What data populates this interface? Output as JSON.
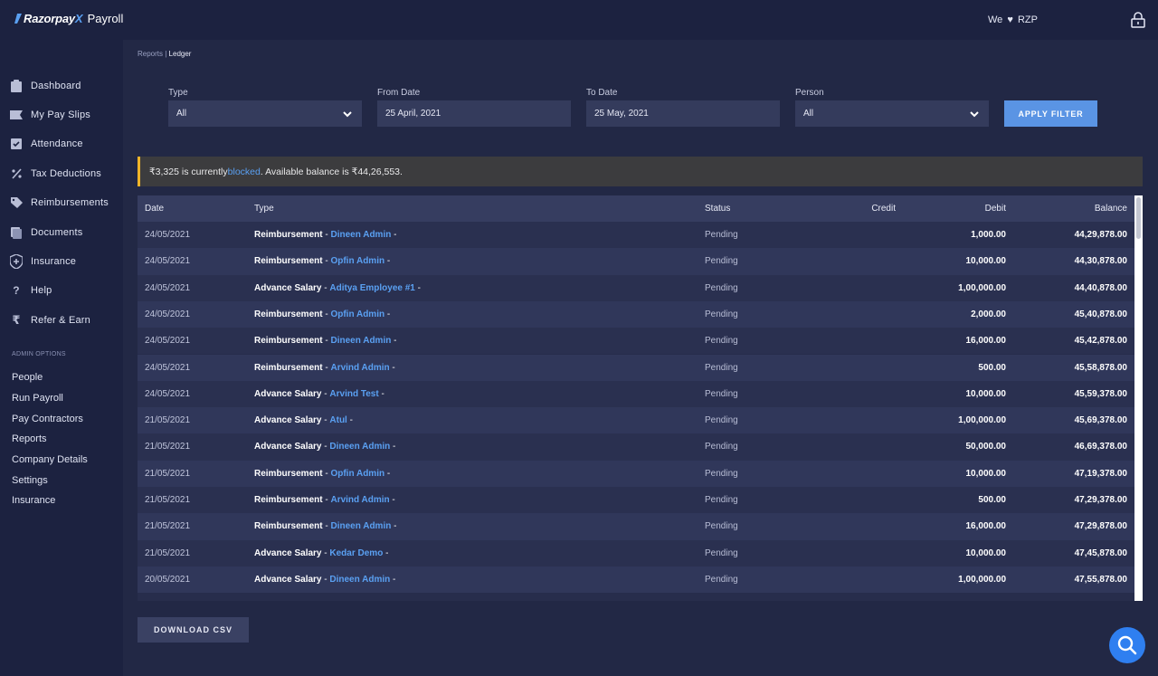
{
  "header": {
    "brand": "Razorpay",
    "brand_mark": "X",
    "product": "Payroll",
    "love_prefix": "We",
    "love_heart": "♥",
    "love_suffix": "RZP"
  },
  "sidebar": {
    "items": [
      {
        "label": "Dashboard",
        "icon": "clipboard-icon"
      },
      {
        "label": "My Pay Slips",
        "icon": "payslip-icon"
      },
      {
        "label": "Attendance",
        "icon": "attendance-check-icon"
      },
      {
        "label": "Tax Deductions",
        "icon": "percent-icon"
      },
      {
        "label": "Reimbursements",
        "icon": "tag-icon"
      },
      {
        "label": "Documents",
        "icon": "documents-icon"
      },
      {
        "label": "Insurance",
        "icon": "shield-plus-icon"
      },
      {
        "label": "Help",
        "icon": "question-icon"
      },
      {
        "label": "Refer & Earn",
        "icon": "rupee-icon"
      }
    ],
    "admin_title": "ADMIN OPTIONS",
    "admin_items": [
      "People",
      "Run Payroll",
      "Pay Contractors",
      "Reports",
      "Company Details",
      "Settings",
      "Insurance"
    ]
  },
  "breadcrumb": {
    "parent": "Reports",
    "separator": " | ",
    "current": "Ledger"
  },
  "filters": {
    "type_label": "Type",
    "type_value": "All",
    "from_label": "From Date",
    "from_value": "25 April, 2021",
    "to_label": "To Date",
    "to_value": "25 May, 2021",
    "person_label": "Person",
    "person_value": "All",
    "apply_label": "APPLY FILTER"
  },
  "alert": {
    "prefix": "₹3,325 is currently ",
    "link": "blocked",
    "suffix": ". Available balance is ₹44,26,553."
  },
  "table": {
    "headers": {
      "date": "Date",
      "type": "Type",
      "status": "Status",
      "credit": "Credit",
      "debit": "Debit",
      "balance": "Balance"
    },
    "rows": [
      {
        "date": "24/05/2021",
        "kind": "Reimbursement",
        "who": "Dineen Admin",
        "status": "Pending",
        "credit": "",
        "debit": "1,000.00",
        "balance": "44,29,878.00"
      },
      {
        "date": "24/05/2021",
        "kind": "Reimbursement",
        "who": "Opfin Admin",
        "status": "Pending",
        "credit": "",
        "debit": "10,000.00",
        "balance": "44,30,878.00"
      },
      {
        "date": "24/05/2021",
        "kind": "Advance Salary",
        "who": "Aditya Employee #1",
        "status": "Pending",
        "credit": "",
        "debit": "1,00,000.00",
        "balance": "44,40,878.00"
      },
      {
        "date": "24/05/2021",
        "kind": "Reimbursement",
        "who": "Opfin Admin",
        "status": "Pending",
        "credit": "",
        "debit": "2,000.00",
        "balance": "45,40,878.00"
      },
      {
        "date": "24/05/2021",
        "kind": "Reimbursement",
        "who": "Dineen Admin",
        "status": "Pending",
        "credit": "",
        "debit": "16,000.00",
        "balance": "45,42,878.00"
      },
      {
        "date": "24/05/2021",
        "kind": "Reimbursement",
        "who": "Arvind Admin",
        "status": "Pending",
        "credit": "",
        "debit": "500.00",
        "balance": "45,58,878.00"
      },
      {
        "date": "24/05/2021",
        "kind": "Advance Salary",
        "who": "Arvind Test",
        "status": "Pending",
        "credit": "",
        "debit": "10,000.00",
        "balance": "45,59,378.00"
      },
      {
        "date": "21/05/2021",
        "kind": "Advance Salary",
        "who": "Atul",
        "status": "Pending",
        "credit": "",
        "debit": "1,00,000.00",
        "balance": "45,69,378.00"
      },
      {
        "date": "21/05/2021",
        "kind": "Advance Salary",
        "who": "Dineen Admin",
        "status": "Pending",
        "credit": "",
        "debit": "50,000.00",
        "balance": "46,69,378.00"
      },
      {
        "date": "21/05/2021",
        "kind": "Reimbursement",
        "who": "Opfin Admin",
        "status": "Pending",
        "credit": "",
        "debit": "10,000.00",
        "balance": "47,19,378.00"
      },
      {
        "date": "21/05/2021",
        "kind": "Reimbursement",
        "who": "Arvind Admin",
        "status": "Pending",
        "credit": "",
        "debit": "500.00",
        "balance": "47,29,378.00"
      },
      {
        "date": "21/05/2021",
        "kind": "Reimbursement",
        "who": "Dineen Admin",
        "status": "Pending",
        "credit": "",
        "debit": "16,000.00",
        "balance": "47,29,878.00"
      },
      {
        "date": "21/05/2021",
        "kind": "Advance Salary",
        "who": "Kedar Demo",
        "status": "Pending",
        "credit": "",
        "debit": "10,000.00",
        "balance": "47,45,878.00"
      },
      {
        "date": "20/05/2021",
        "kind": "Advance Salary",
        "who": "Dineen Admin",
        "status": "Pending",
        "credit": "",
        "debit": "1,00,000.00",
        "balance": "47,55,878.00"
      }
    ]
  },
  "download_label": "DOWNLOAD CSV",
  "colors": {
    "accent": "#5a94e4",
    "link": "#5aa0f2",
    "alert_border": "#f0b429",
    "fab": "#2f7ff0"
  }
}
